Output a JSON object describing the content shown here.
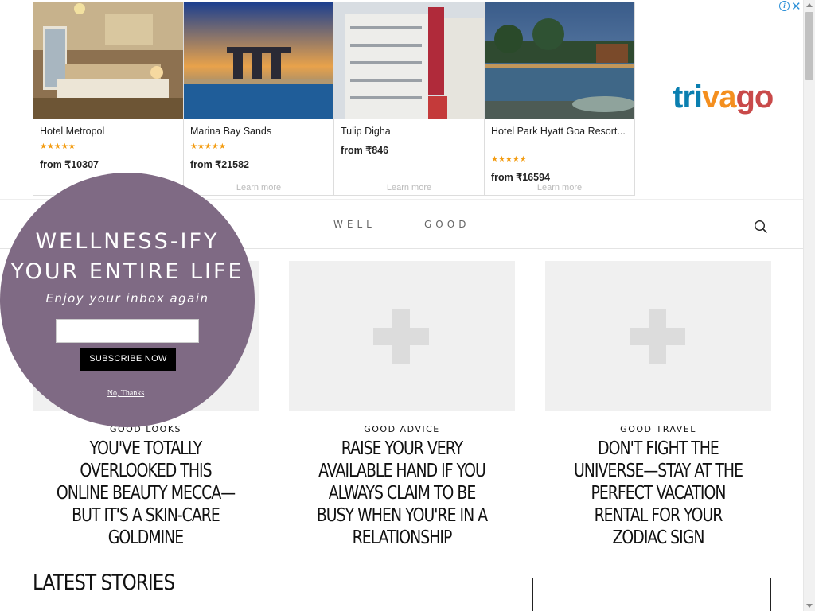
{
  "ad": {
    "hotels": [
      {
        "name": "Hotel Metropol",
        "stars": "★★★★★",
        "price_prefix": "from",
        "price": "₹10307",
        "learn": ""
      },
      {
        "name": "Marina Bay Sands",
        "stars": "★★★★★",
        "price_prefix": "from",
        "price": "₹21582",
        "learn": "Learn more"
      },
      {
        "name": "Tulip Digha",
        "stars": "",
        "price_prefix": "from",
        "price": "₹846",
        "learn": "Learn more"
      },
      {
        "name": "Hotel Park Hyatt Goa Resort...",
        "stars": "★★★★★",
        "price_prefix": "from",
        "price": "₹16594",
        "learn": "Learn more"
      }
    ],
    "brand_parts": [
      "tri",
      "va",
      "go"
    ],
    "adchoices_glyph": "i",
    "close_glyph": "✕",
    "colors": {
      "brand_blue": "#0a7fb0",
      "brand_orange": "#f48f1f",
      "brand_red": "#c94a4a",
      "stars": "#f39c12"
    }
  },
  "header": {
    "brand_left": "WELL",
    "brand_right": "GOOD",
    "search_icon": "search-icon"
  },
  "cards": [
    {
      "category": "GOOD LOOKS",
      "title": "YOU'VE TOTALLY OVERLOOKED THIS ONLINE BEAUTY MECCA—BUT IT'S A SKIN-CARE GOLDMINE"
    },
    {
      "category": "GOOD ADVICE",
      "title": "RAISE YOUR VERY AVAILABLE HAND IF YOU ALWAYS CLAIM TO BE BUSY WHEN YOU'RE IN A RELATIONSHIP"
    },
    {
      "category": "GOOD TRAVEL",
      "title": "DON'T FIGHT THE UNIVERSE—STAY AT THE PERFECT VACATION RENTAL FOR YOUR ZODIAC SIGN"
    }
  ],
  "latest": {
    "title": "LATEST STORIES"
  },
  "popup": {
    "title": "WELLNESS-IFY YOUR ENTIRE LIFE",
    "subtitle": "Enjoy your inbox again",
    "email_value": "",
    "subscribe_label": "SUBSCRIBE NOW",
    "dismiss_label": "No, Thanks",
    "color": "#7f6a84"
  }
}
